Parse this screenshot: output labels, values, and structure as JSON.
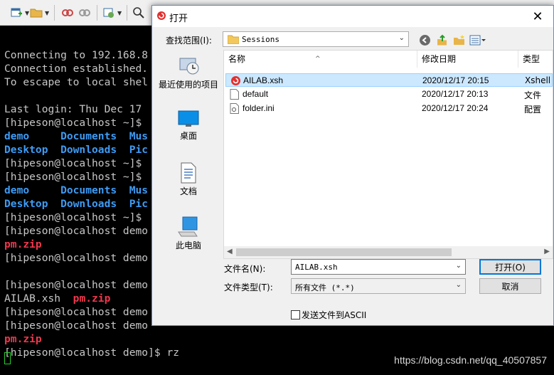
{
  "toolbar": {
    "icons": [
      "new-session-icon",
      "open-folder-icon",
      "disconnect-icon",
      "reconnect-icon",
      "properties-icon",
      "find-icon"
    ]
  },
  "terminal": {
    "lines": [
      {
        "text": ""
      },
      {
        "text": ""
      },
      {
        "segments": [
          {
            "t": "Connecting to 192.168.8",
            "c": ""
          }
        ]
      },
      {
        "segments": [
          {
            "t": "Connection established.",
            "c": ""
          }
        ]
      },
      {
        "segments": [
          {
            "t": "To escape to local shel",
            "c": ""
          }
        ]
      },
      {
        "text": ""
      },
      {
        "segments": [
          {
            "t": "Last login: Thu Dec 17",
            "c": ""
          }
        ]
      },
      {
        "segments": [
          {
            "t": "[hipeson@localhost ~]$",
            "c": ""
          }
        ]
      },
      {
        "segments": [
          {
            "t": "demo     ",
            "c": "b"
          },
          {
            "t": "Documents  ",
            "c": "b"
          },
          {
            "t": "Mus",
            "c": "b"
          }
        ]
      },
      {
        "segments": [
          {
            "t": "Desktop  ",
            "c": "b"
          },
          {
            "t": "Downloads  ",
            "c": "b"
          },
          {
            "t": "Pic",
            "c": "b"
          }
        ]
      },
      {
        "segments": [
          {
            "t": "[hipeson@localhost ~]$",
            "c": ""
          }
        ]
      },
      {
        "segments": [
          {
            "t": "[hipeson@localhost ~]$",
            "c": ""
          }
        ]
      },
      {
        "segments": [
          {
            "t": "demo     ",
            "c": "b"
          },
          {
            "t": "Documents  ",
            "c": "b"
          },
          {
            "t": "Mus",
            "c": "b"
          }
        ]
      },
      {
        "segments": [
          {
            "t": "Desktop  ",
            "c": "b"
          },
          {
            "t": "Downloads  ",
            "c": "b"
          },
          {
            "t": "Pic",
            "c": "b"
          }
        ]
      },
      {
        "segments": [
          {
            "t": "[hipeson@localhost ~]$",
            "c": ""
          }
        ]
      },
      {
        "segments": [
          {
            "t": "[hipeson@localhost demo",
            "c": ""
          }
        ]
      },
      {
        "segments": [
          {
            "t": "pm.zip",
            "c": "r"
          }
        ]
      },
      {
        "segments": [
          {
            "t": "[hipeson@localhost demo",
            "c": ""
          }
        ]
      },
      {
        "text": ""
      },
      {
        "segments": [
          {
            "t": "[hipeson@localhost demo",
            "c": ""
          }
        ]
      },
      {
        "segments": [
          {
            "t": "AILAB.xsh  ",
            "c": ""
          },
          {
            "t": "pm.zip",
            "c": "r"
          }
        ]
      },
      {
        "segments": [
          {
            "t": "[hipeson@localhost demo",
            "c": ""
          }
        ]
      },
      {
        "segments": [
          {
            "t": "[hipeson@localhost demo",
            "c": ""
          }
        ]
      },
      {
        "segments": [
          {
            "t": "pm.zip",
            "c": "r"
          }
        ]
      },
      {
        "segments": [
          {
            "t": "[hipeson@localhost demo]$ rz",
            "c": ""
          }
        ]
      }
    ],
    "watermark": "https://blog.csdn.net/qq_40507857"
  },
  "dialog": {
    "title": "打开",
    "close": "✕",
    "lookin_label": "查找范围(I):",
    "lookin_value": "Sessions",
    "places": [
      {
        "label": "最近使用的项目",
        "icon": "recent-places-icon"
      },
      {
        "label": "桌面",
        "icon": "desktop-icon"
      },
      {
        "label": "文档",
        "icon": "documents-icon"
      },
      {
        "label": "此电脑",
        "icon": "this-pc-icon"
      }
    ],
    "columns": {
      "name": "名称",
      "modified": "修改日期",
      "type": "类型"
    },
    "files": [
      {
        "name": "AILAB.xsh",
        "modified": "2020/12/17 20:15",
        "type": "Xshell",
        "icon": "xshell-session-icon",
        "selected": true
      },
      {
        "name": "default",
        "modified": "2020/12/17 20:13",
        "type": "文件",
        "icon": "blank-file-icon",
        "selected": false
      },
      {
        "name": "folder.ini",
        "modified": "2020/12/17 20:24",
        "type": "配置",
        "icon": "config-file-icon",
        "selected": false
      }
    ],
    "filename_label": "文件名(N):",
    "filename_value": "AILAB.xsh",
    "filetype_label": "文件类型(T):",
    "filetype_value": "所有文件 (*.*)",
    "open_button": "打开(O)",
    "cancel_button": "取消",
    "ascii_label": "发送文件到ASCII",
    "ascii_checked": false
  }
}
